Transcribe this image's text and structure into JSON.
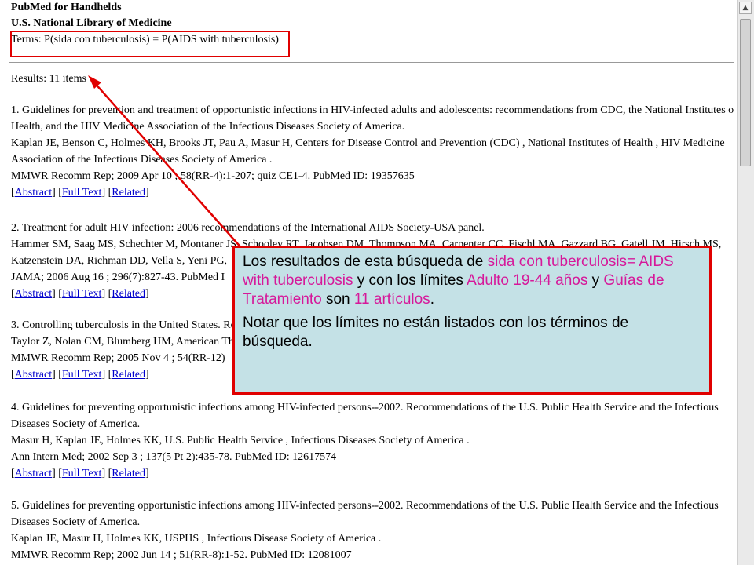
{
  "header": {
    "app_title": "PubMed for Handhelds",
    "org": "U.S. National Library of Medicine",
    "terms": "Terms: P(sida con tuberculosis) = P(AIDS with tuberculosis)"
  },
  "results_label": "Results: 11 items",
  "links": {
    "abstract": "Abstract",
    "fulltext": "Full Text",
    "related": "Related"
  },
  "results": [
    {
      "line1": "1. Guidelines for prevention and treatment of opportunistic infections in HIV-infected adults and adolescents: recommendations from CDC, the National Institutes of",
      "line2": "Health, and the HIV Medicine Association of the Infectious Diseases Society of America.",
      "line3": "Kaplan JE, Benson C, Holmes KH, Brooks JT, Pau A, Masur H, Centers for Disease Control and Prevention (CDC) , National Institutes of Health , HIV Medicine",
      "line4": "Association of the Infectious Diseases Society of America .",
      "line5": "MMWR Recomm Rep; 2009 Apr 10 ; 58(RR-4):1-207; quiz CE1-4. PubMed ID: 19357635"
    },
    {
      "line1": "2. Treatment for adult HIV infection: 2006 recommendations of the International AIDS Society-USA panel.",
      "line2": "Hammer SM, Saag MS, Schechter M, Montaner JS, Schooley RT, Jacobsen DM, Thompson MA, Carpenter CC, Fischl MA, Gazzard BG, Gatell JM, Hirsch MS,",
      "line3": "Katzenstein DA, Richman DD, Vella S, Yeni PG,",
      "line4": "JAMA; 2006 Aug 16 ; 296(7):827-43. PubMed I"
    },
    {
      "line1": "3. Controlling tuberculosis in the United States. Re",
      "line2": "Taylor Z, Nolan CM, Blumberg HM, American Th",
      "line3": "MMWR Recomm Rep; 2005 Nov 4 ; 54(RR-12)"
    },
    {
      "line1": "4. Guidelines for preventing opportunistic infections among HIV-infected persons--2002. Recommendations of the U.S. Public Health Service and the Infectious",
      "line2": "Diseases Society of America.",
      "line3": "Masur H, Kaplan JE, Holmes KK, U.S. Public Health Service , Infectious Diseases Society of America .",
      "line4": "Ann Intern Med; 2002 Sep 3 ; 137(5 Pt 2):435-78. PubMed ID: 12617574"
    },
    {
      "line1": "5. Guidelines for preventing opportunistic infections among HIV-infected persons--2002. Recommendations of the U.S. Public Health Service and the Infectious",
      "line2": "Diseases Society of America.",
      "line3": "Kaplan JE, Masur H, Holmes KK, USPHS , Infectious Disease Society of America .",
      "line4": "MMWR Recomm Rep; 2002 Jun 14 ; 51(RR-8):1-52. PubMed ID: 12081007"
    }
  ],
  "callout": {
    "p1_a": "Los resultados de esta búsqueda de ",
    "p1_b": "sida con tuberculosis= AIDS with tuberculosis",
    "p1_c": " y con los límites ",
    "p1_d": "Adulto 19-44 años",
    "p1_e": " y ",
    "p1_f": "Guías de Tratamiento",
    "p1_g": " son ",
    "p1_h": "11 artículos",
    "p1_i": ".",
    "p2": "Notar que los límites no están listados con los términos de búsqueda."
  },
  "colors": {
    "highlight": "#e00000",
    "accent_text": "#d6189a",
    "callout_bg": "#c4e1e6",
    "link": "#0000cc"
  },
  "icons": {
    "scroll_up": "scroll-up-arrow-icon"
  }
}
